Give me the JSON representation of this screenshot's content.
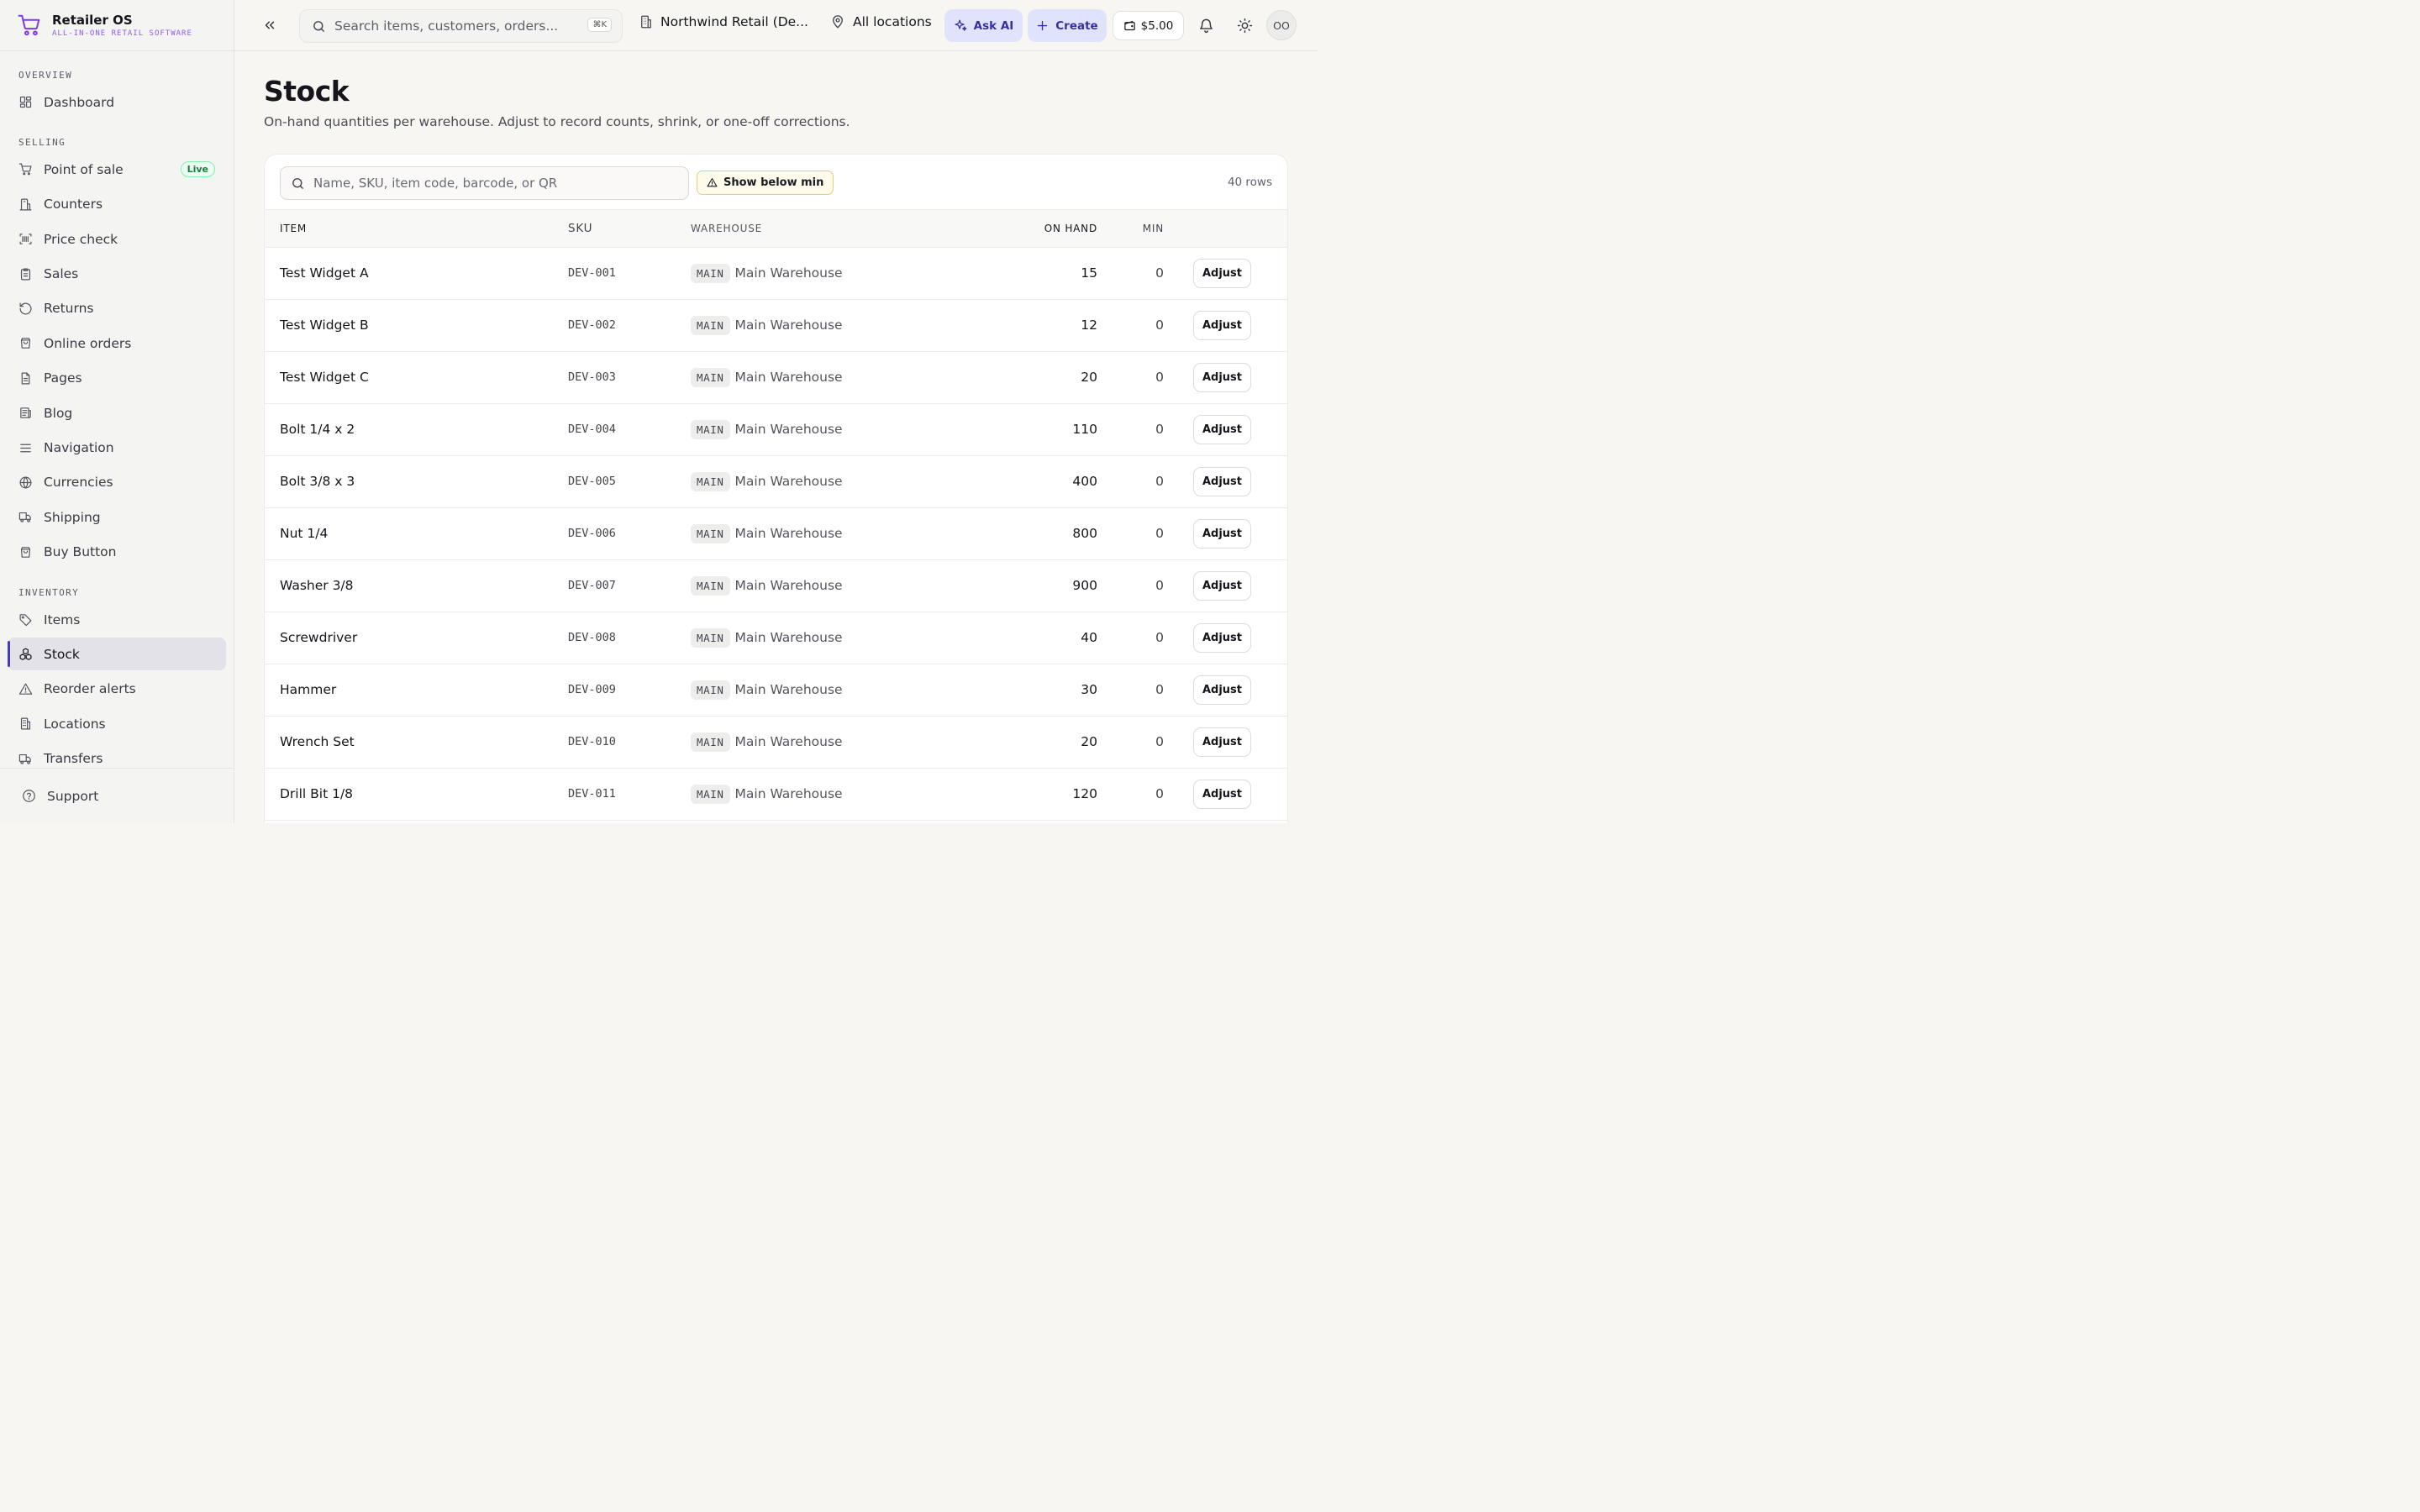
{
  "brand": {
    "title": "Retailer OS",
    "subtitle": "ALL-IN-ONE RETAIL SOFTWARE"
  },
  "sidebar": {
    "sections": [
      {
        "label": "OVERVIEW",
        "items": [
          {
            "label": "Dashboard",
            "icon": "dashboard-icon"
          }
        ]
      },
      {
        "label": "SELLING",
        "items": [
          {
            "label": "Point of sale",
            "icon": "cart-icon",
            "badge": "Live"
          },
          {
            "label": "Counters",
            "icon": "counter-icon"
          },
          {
            "label": "Price check",
            "icon": "barcode-icon"
          },
          {
            "label": "Sales",
            "icon": "clipboard-icon"
          },
          {
            "label": "Returns",
            "icon": "undo-icon"
          },
          {
            "label": "Online orders",
            "icon": "bag-icon"
          },
          {
            "label": "Pages",
            "icon": "file-icon"
          },
          {
            "label": "Blog",
            "icon": "newspaper-icon"
          },
          {
            "label": "Navigation",
            "icon": "menu-icon"
          },
          {
            "label": "Currencies",
            "icon": "globe-icon"
          },
          {
            "label": "Shipping",
            "icon": "truck-icon"
          },
          {
            "label": "Buy Button",
            "icon": "bag-icon"
          }
        ]
      },
      {
        "label": "INVENTORY",
        "items": [
          {
            "label": "Items",
            "icon": "tag-icon"
          },
          {
            "label": "Stock",
            "icon": "boxes-icon",
            "active": true
          },
          {
            "label": "Reorder alerts",
            "icon": "warning-icon"
          },
          {
            "label": "Locations",
            "icon": "building-icon"
          },
          {
            "label": "Transfers",
            "icon": "truck-icon"
          }
        ]
      }
    ],
    "footer": {
      "label": "Support",
      "icon": "help-icon"
    }
  },
  "topbar": {
    "search_placeholder": "Search items, customers, orders...",
    "search_shortcut": "⌘K",
    "org_name": "Northwind Retail (De...",
    "location": "All locations",
    "ask_ai_label": "Ask AI",
    "create_label": "Create",
    "wallet_balance": "$5.00",
    "avatar_initials": "OO"
  },
  "page": {
    "title": "Stock",
    "description": "On-hand quantities per warehouse. Adjust to record counts, shrink, or one-off corrections.",
    "filter_placeholder": "Name, SKU, item code, barcode, or QR",
    "below_min_label": "Show below min",
    "rows_count": "40 rows"
  },
  "table": {
    "headers": {
      "item": "ITEM",
      "sku": "SKU",
      "warehouse": "WAREHOUSE",
      "on_hand": "ON HAND",
      "min": "MIN"
    },
    "action_label": "Adjust",
    "rows": [
      {
        "item": "Test Widget A",
        "sku": "DEV-001",
        "wh_code": "MAIN",
        "wh_name": "Main Warehouse",
        "on_hand": "15",
        "min": "0"
      },
      {
        "item": "Test Widget B",
        "sku": "DEV-002",
        "wh_code": "MAIN",
        "wh_name": "Main Warehouse",
        "on_hand": "12",
        "min": "0"
      },
      {
        "item": "Test Widget C",
        "sku": "DEV-003",
        "wh_code": "MAIN",
        "wh_name": "Main Warehouse",
        "on_hand": "20",
        "min": "0"
      },
      {
        "item": "Bolt 1/4 x 2",
        "sku": "DEV-004",
        "wh_code": "MAIN",
        "wh_name": "Main Warehouse",
        "on_hand": "110",
        "min": "0"
      },
      {
        "item": "Bolt 3/8 x 3",
        "sku": "DEV-005",
        "wh_code": "MAIN",
        "wh_name": "Main Warehouse",
        "on_hand": "400",
        "min": "0"
      },
      {
        "item": "Nut 1/4",
        "sku": "DEV-006",
        "wh_code": "MAIN",
        "wh_name": "Main Warehouse",
        "on_hand": "800",
        "min": "0"
      },
      {
        "item": "Washer 3/8",
        "sku": "DEV-007",
        "wh_code": "MAIN",
        "wh_name": "Main Warehouse",
        "on_hand": "900",
        "min": "0"
      },
      {
        "item": "Screwdriver",
        "sku": "DEV-008",
        "wh_code": "MAIN",
        "wh_name": "Main Warehouse",
        "on_hand": "40",
        "min": "0"
      },
      {
        "item": "Hammer",
        "sku": "DEV-009",
        "wh_code": "MAIN",
        "wh_name": "Main Warehouse",
        "on_hand": "30",
        "min": "0"
      },
      {
        "item": "Wrench Set",
        "sku": "DEV-010",
        "wh_code": "MAIN",
        "wh_name": "Main Warehouse",
        "on_hand": "20",
        "min": "0"
      },
      {
        "item": "Drill Bit 1/8",
        "sku": "DEV-011",
        "wh_code": "MAIN",
        "wh_name": "Main Warehouse",
        "on_hand": "120",
        "min": "0"
      }
    ]
  },
  "colors": {
    "accent": "#4338ca",
    "brand": "#7c3aed",
    "live": "#15803d",
    "warning_border": "#f0c97a"
  }
}
